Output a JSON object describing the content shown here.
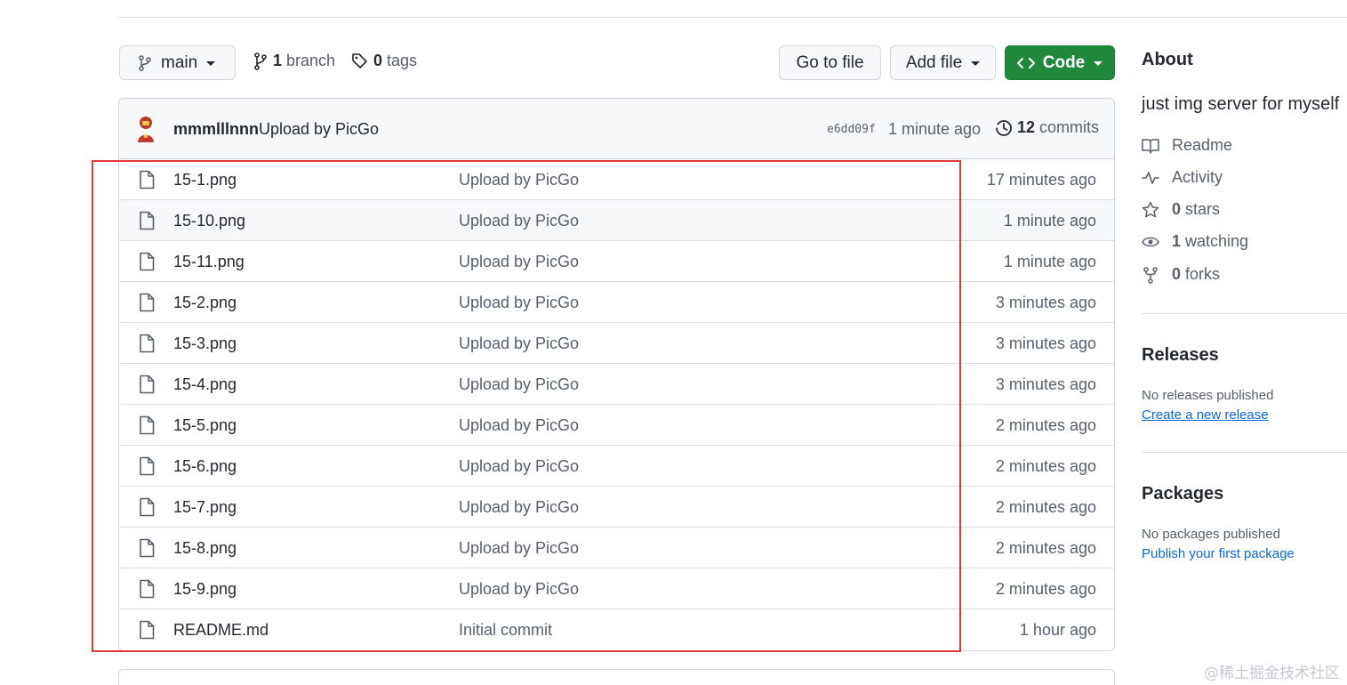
{
  "toolbar": {
    "branch_label": "main",
    "branches_count": "1",
    "branches_label": "branch",
    "tags_count": "0",
    "tags_label": "tags",
    "go_to_file": "Go to file",
    "add_file": "Add file",
    "code": "Code"
  },
  "commit": {
    "author": "mmmlllnnn",
    "message": "Upload by PicGo",
    "sha": "e6dd09f",
    "time": "1 minute ago",
    "commits_count": "12",
    "commits_label": "commits"
  },
  "files": [
    {
      "name": "15-1.png",
      "message": "Upload by PicGo",
      "age": "17 minutes ago"
    },
    {
      "name": "15-10.png",
      "message": "Upload by PicGo",
      "age": "1 minute ago"
    },
    {
      "name": "15-11.png",
      "message": "Upload by PicGo",
      "age": "1 minute ago"
    },
    {
      "name": "15-2.png",
      "message": "Upload by PicGo",
      "age": "3 minutes ago"
    },
    {
      "name": "15-3.png",
      "message": "Upload by PicGo",
      "age": "3 minutes ago"
    },
    {
      "name": "15-4.png",
      "message": "Upload by PicGo",
      "age": "3 minutes ago"
    },
    {
      "name": "15-5.png",
      "message": "Upload by PicGo",
      "age": "2 minutes ago"
    },
    {
      "name": "15-6.png",
      "message": "Upload by PicGo",
      "age": "2 minutes ago"
    },
    {
      "name": "15-7.png",
      "message": "Upload by PicGo",
      "age": "2 minutes ago"
    },
    {
      "name": "15-8.png",
      "message": "Upload by PicGo",
      "age": "2 minutes ago"
    },
    {
      "name": "15-9.png",
      "message": "Upload by PicGo",
      "age": "2 minutes ago"
    },
    {
      "name": "README.md",
      "message": "Initial commit",
      "age": "1 hour ago"
    }
  ],
  "about": {
    "heading": "About",
    "description": "just img server for myself",
    "readme": "Readme",
    "activity": "Activity",
    "stars_count": "0",
    "stars_label": "stars",
    "watching_count": "1",
    "watching_label": "watching",
    "forks_count": "0",
    "forks_label": "forks"
  },
  "releases": {
    "heading": "Releases",
    "empty": "No releases published",
    "link": "Create a new release"
  },
  "packages": {
    "heading": "Packages",
    "empty": "No packages published",
    "link": "Publish your first package"
  },
  "watermark": "@稀土掘金技术社区",
  "colors": {
    "code_button": "#1f883d",
    "highlight_box": "#e0393a",
    "link": "#0969da"
  }
}
